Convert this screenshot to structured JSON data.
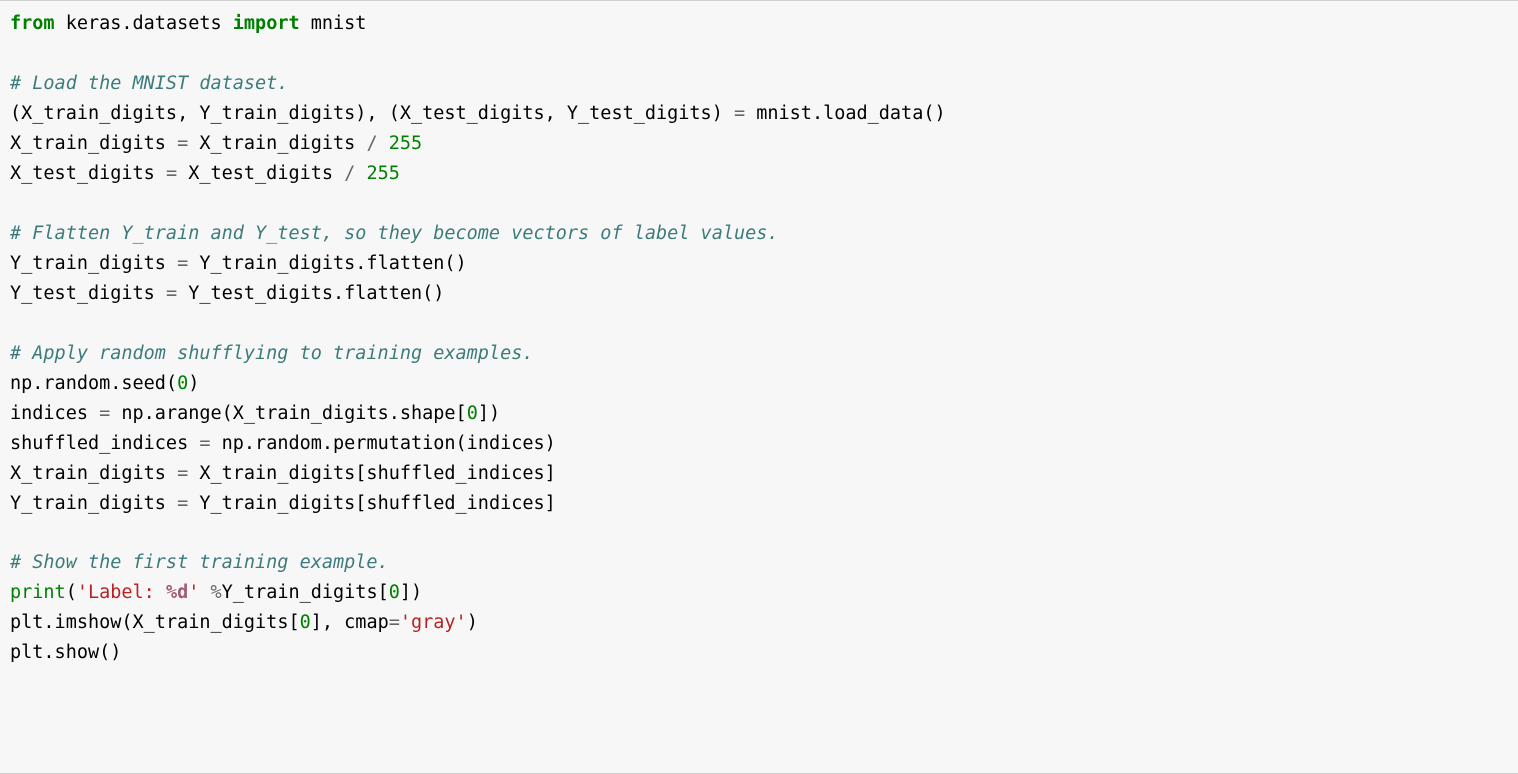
{
  "code": {
    "lang": "python",
    "lines": {
      "l01_kw_from": "from",
      "l01_mod1": "keras.datasets",
      "l01_kw_import": "import",
      "l01_mod2": "mnist",
      "l03_comment": "# Load the MNIST dataset.",
      "l04_a": "(X_train_digits, Y_train_digits), (X_test_digits, Y_test_digits)",
      "l04_op": "=",
      "l04_b": "mnist",
      "l04_c": ".load_data()",
      "l05_a": "X_train_digits",
      "l05_op1": "=",
      "l05_b": "X_train_digits",
      "l05_op2": "/",
      "l05_num": "255",
      "l06_a": "X_test_digits",
      "l06_op1": "=",
      "l06_b": "X_test_digits",
      "l06_op2": "/",
      "l06_num": "255",
      "l08_comment": "# Flatten Y_train and Y_test, so they become vectors of label values.",
      "l09_a": "Y_train_digits",
      "l09_op": "=",
      "l09_b": "Y_train_digits",
      "l09_c": ".flatten()",
      "l10_a": "Y_test_digits",
      "l10_op": "=",
      "l10_b": "Y_test_digits",
      "l10_c": ".flatten()",
      "l12_comment": "# Apply random shufflying to training examples.",
      "l13_a": "np",
      "l13_b": ".random",
      "l13_c": ".seed(",
      "l13_num": "0",
      "l13_d": ")",
      "l14_a": "indices",
      "l14_op": "=",
      "l14_b": "np",
      "l14_c": ".arange(X_train_digits",
      "l14_d": ".shape[",
      "l14_num": "0",
      "l14_e": "])",
      "l15_a": "shuffled_indices",
      "l15_op": "=",
      "l15_b": "np",
      "l15_c": ".random",
      "l15_d": ".permutation(indices)",
      "l16_a": "X_train_digits",
      "l16_op": "=",
      "l16_b": "X_train_digits[shuffled_indices]",
      "l17_a": "Y_train_digits",
      "l17_op": "=",
      "l17_b": "Y_train_digits[shuffled_indices]",
      "l19_comment": "# Show the first training example.",
      "l20_bi": "print",
      "l20_a": "(",
      "l20_s1": "'Label: ",
      "l20_si": "%d",
      "l20_s2": "'",
      "l20_b": " ",
      "l20_op": "%",
      "l20_c": "Y_train_digits[",
      "l20_num": "0",
      "l20_d": "])",
      "l21_a": "plt",
      "l21_b": ".imshow(X_train_digits[",
      "l21_num": "0",
      "l21_c": "], cmap",
      "l21_op": "=",
      "l21_s": "'gray'",
      "l21_d": ")",
      "l22_a": "plt",
      "l22_b": ".show()"
    }
  }
}
